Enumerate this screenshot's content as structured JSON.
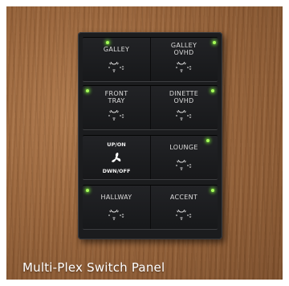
{
  "caption": "Multi-Plex Switch Panel",
  "indicator_color": "#a7ff5a",
  "panel_color": "#1b1c1e",
  "switches": [
    {
      "label": "GALLEY",
      "icon": "light-bulb-icon"
    },
    {
      "label": "GALLEY\nOVHD",
      "icon": "light-bulb-icon"
    },
    {
      "label": "FRONT\nTRAY",
      "icon": "light-bulb-icon"
    },
    {
      "label": "DINETTE\nOVHD",
      "icon": "light-bulb-icon"
    },
    {
      "label_top": "UP/ON",
      "label_bottom": "DWN/OFF",
      "icon": "fan-icon"
    },
    {
      "label": "LOUNGE",
      "icon": "light-bulb-icon"
    },
    {
      "label": "HALLWAY",
      "icon": "light-bulb-icon"
    },
    {
      "label": "ACCENT",
      "icon": "light-bulb-icon"
    }
  ]
}
